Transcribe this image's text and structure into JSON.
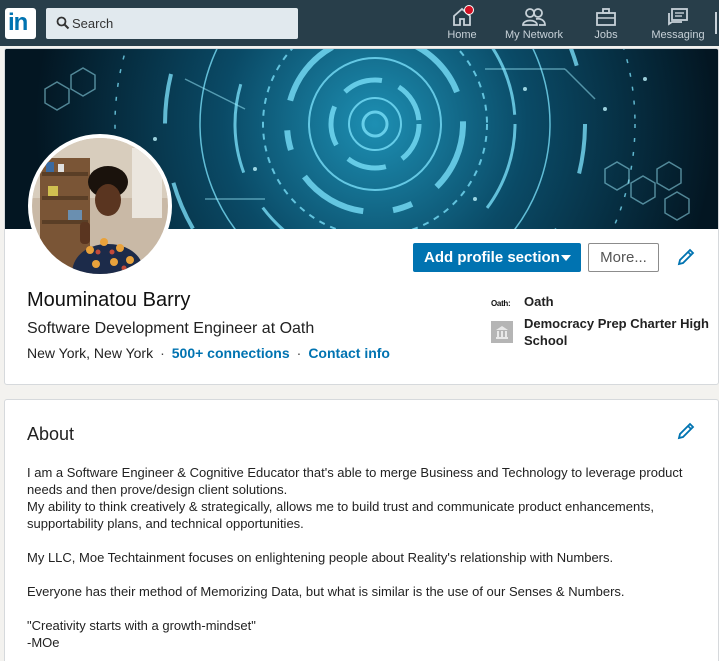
{
  "nav": {
    "logo": "in",
    "search_placeholder": "Search",
    "items": [
      {
        "label": "Home",
        "icon": "home-icon"
      },
      {
        "label": "My Network",
        "icon": "network-icon"
      },
      {
        "label": "Jobs",
        "icon": "briefcase-icon"
      },
      {
        "label": "Messaging",
        "icon": "messaging-icon"
      }
    ],
    "colors": {
      "bar": "#283e4a",
      "badge": "#d11124"
    }
  },
  "profile": {
    "name": "Mouminatou Barry",
    "headline": "Software Development Engineer at Oath",
    "location": "New York, New York",
    "connections": "500+ connections",
    "contact": "Contact info",
    "separator": "·",
    "add_section_label": "Add profile section",
    "more_label": "More...",
    "orgs": [
      {
        "name": "Oath",
        "logo_text": "Oath:"
      },
      {
        "name": "Democracy Prep Charter High School"
      }
    ],
    "accent": "#0073b1"
  },
  "about": {
    "title": "About",
    "lines": [
      "I am a Software Engineer & Cognitive Educator that's able to merge Business and Technology to leverage product needs and then prove/design client solutions.",
      "My ability to think creatively & strategically, allows me to build trust and communicate product enhancements, supportability plans, and technical opportunities.",
      "",
      "My LLC, Moe Techtainment focuses on enlightening people about Reality's relationship with Numbers.",
      "",
      "Everyone has their method of Memorizing Data, but what is similar is the use of our Senses & Numbers.",
      "",
      "\"Creativity starts with a growth-mindset\"",
      "-MOe"
    ]
  }
}
